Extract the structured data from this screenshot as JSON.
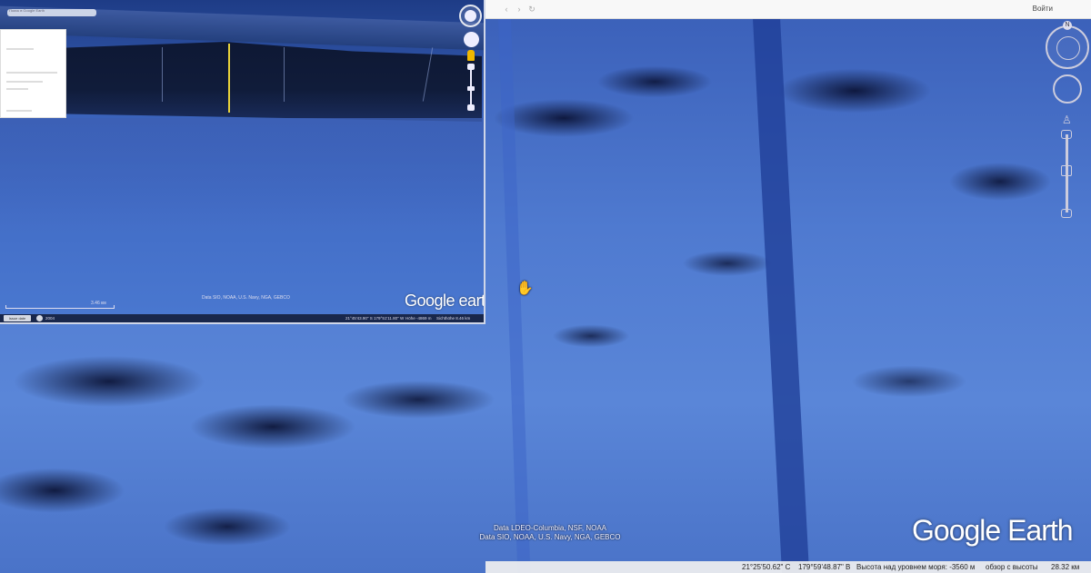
{
  "main": {
    "topbar": {
      "login_label": "Войти",
      "icons": [
        "back-icon",
        "forward-icon",
        "refresh-icon"
      ]
    },
    "attribution": {
      "line1": "Data LDEO-Columbia, NSF, NOAA",
      "line2": "Data SIO, NOAA, U.S. Navy, NGA, GEBCO"
    },
    "logo": "Google Earth",
    "statusbar": {
      "latitude": "21°25'50.62\" С",
      "longitude": "179°59'48.87\" В",
      "elevation": "Высота над уровнем моря: -3560 м",
      "view": "обзор с высоты",
      "eye_alt": "28.32 км"
    },
    "compass_n": "N",
    "pegman": "♙",
    "cursor": "✋"
  },
  "inset": {
    "search_placeholder": "Поиск в Google Earth",
    "scale_label": "3.46 км",
    "attribution": "Data SIO, NOAA, U.S. Navy, NGA, GEBCO",
    "logo": "Google earth",
    "imagery_button": "Issue date",
    "year": "2004",
    "statusbar": {
      "coords": "21°45'43.90\" S  179°51'11.80\" W",
      "elevation": "Höhe -4869 m",
      "eye_alt": "Sichthöhe 8.46 km"
    }
  }
}
